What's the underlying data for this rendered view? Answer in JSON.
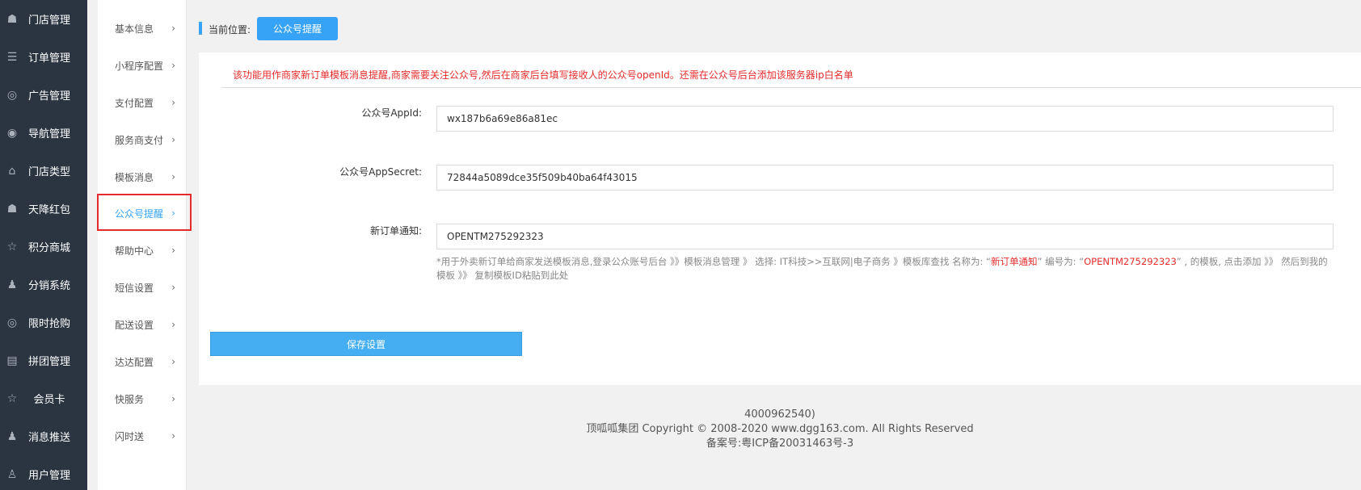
{
  "sidebar": {
    "items": [
      {
        "label": "门店管理",
        "icon": "store-icon",
        "glyph": "☗"
      },
      {
        "label": "订单管理",
        "icon": "list-icon",
        "glyph": "☰"
      },
      {
        "label": "广告管理",
        "icon": "lifebuoy-icon",
        "glyph": "◎"
      },
      {
        "label": "导航管理",
        "icon": "compass-icon",
        "glyph": "◉"
      },
      {
        "label": "门店类型",
        "icon": "bank-icon",
        "glyph": "⌂"
      },
      {
        "label": "天降红包",
        "icon": "redpacket-icon",
        "glyph": "☗"
      },
      {
        "label": "积分商城",
        "icon": "star-icon",
        "glyph": "☆"
      },
      {
        "label": "分销系统",
        "icon": "users-icon",
        "glyph": "♟"
      },
      {
        "label": "限时抢购",
        "icon": "clock-icon",
        "glyph": "◎"
      },
      {
        "label": "拼团管理",
        "icon": "newspaper-icon",
        "glyph": "▤"
      },
      {
        "label": "会员卡",
        "icon": "star-icon",
        "glyph": "☆"
      },
      {
        "label": "消息推送",
        "icon": "users-icon",
        "glyph": "♟"
      },
      {
        "label": "用户管理",
        "icon": "user-icon",
        "glyph": "♙"
      }
    ]
  },
  "subnav": {
    "items": [
      {
        "label": "基本信息"
      },
      {
        "label": "小程序配置"
      },
      {
        "label": "支付配置"
      },
      {
        "label": "服务商支付"
      },
      {
        "label": "模板消息"
      },
      {
        "label": "公众号提醒",
        "active": true
      },
      {
        "label": "帮助中心"
      },
      {
        "label": "短信设置"
      },
      {
        "label": "配送设置"
      },
      {
        "label": "达达配置"
      },
      {
        "label": "快服务"
      },
      {
        "label": "闪时送"
      }
    ],
    "arrow": "›"
  },
  "breadcrumb": {
    "label": "当前位置:",
    "current": "公众号提醒"
  },
  "form": {
    "notice": "该功能用作商家新订单模板消息提醒,商家需要关注公众号,然后在商家后台填写接收人的公众号openId。还需在公众号后台添加该服务器ip白名单",
    "appid_label": "公众号AppId:",
    "appid_value": "wx187b6a69e86a81ec",
    "appsecret_label": "公众号AppSecret:",
    "appsecret_value": "72844a5089dce35f509b40ba64f43015",
    "order_label": "新订单通知:",
    "order_value": "OPENTM275292323",
    "hint_part1": "*用于外卖新订单给商家发送模板消息,登录公众账号后台 》》模板消息管理 》 选择: IT科技>>互联网|电子商务 》模板库查找 名称为: “",
    "hint_red1": "新订单通知",
    "hint_part2": "” 编号为: “",
    "hint_red2": "OPENTM275292323",
    "hint_part3": "” , 的模板, 点击添加 》》 然后到我的模板 》》 复制模板ID粘贴到此处",
    "save_label": "保存设置"
  },
  "footer": {
    "line1": "4000962540)",
    "line2": "顶呱呱集团 Copyright © 2008-2020 www.dgg163.com. All Rights Reserved",
    "line3": "备案号:粤ICP备20031463号-3"
  },
  "colors": {
    "sidebar_bg": "#2b3541",
    "accent": "#36a3f7",
    "danger": "#e52b2b"
  }
}
